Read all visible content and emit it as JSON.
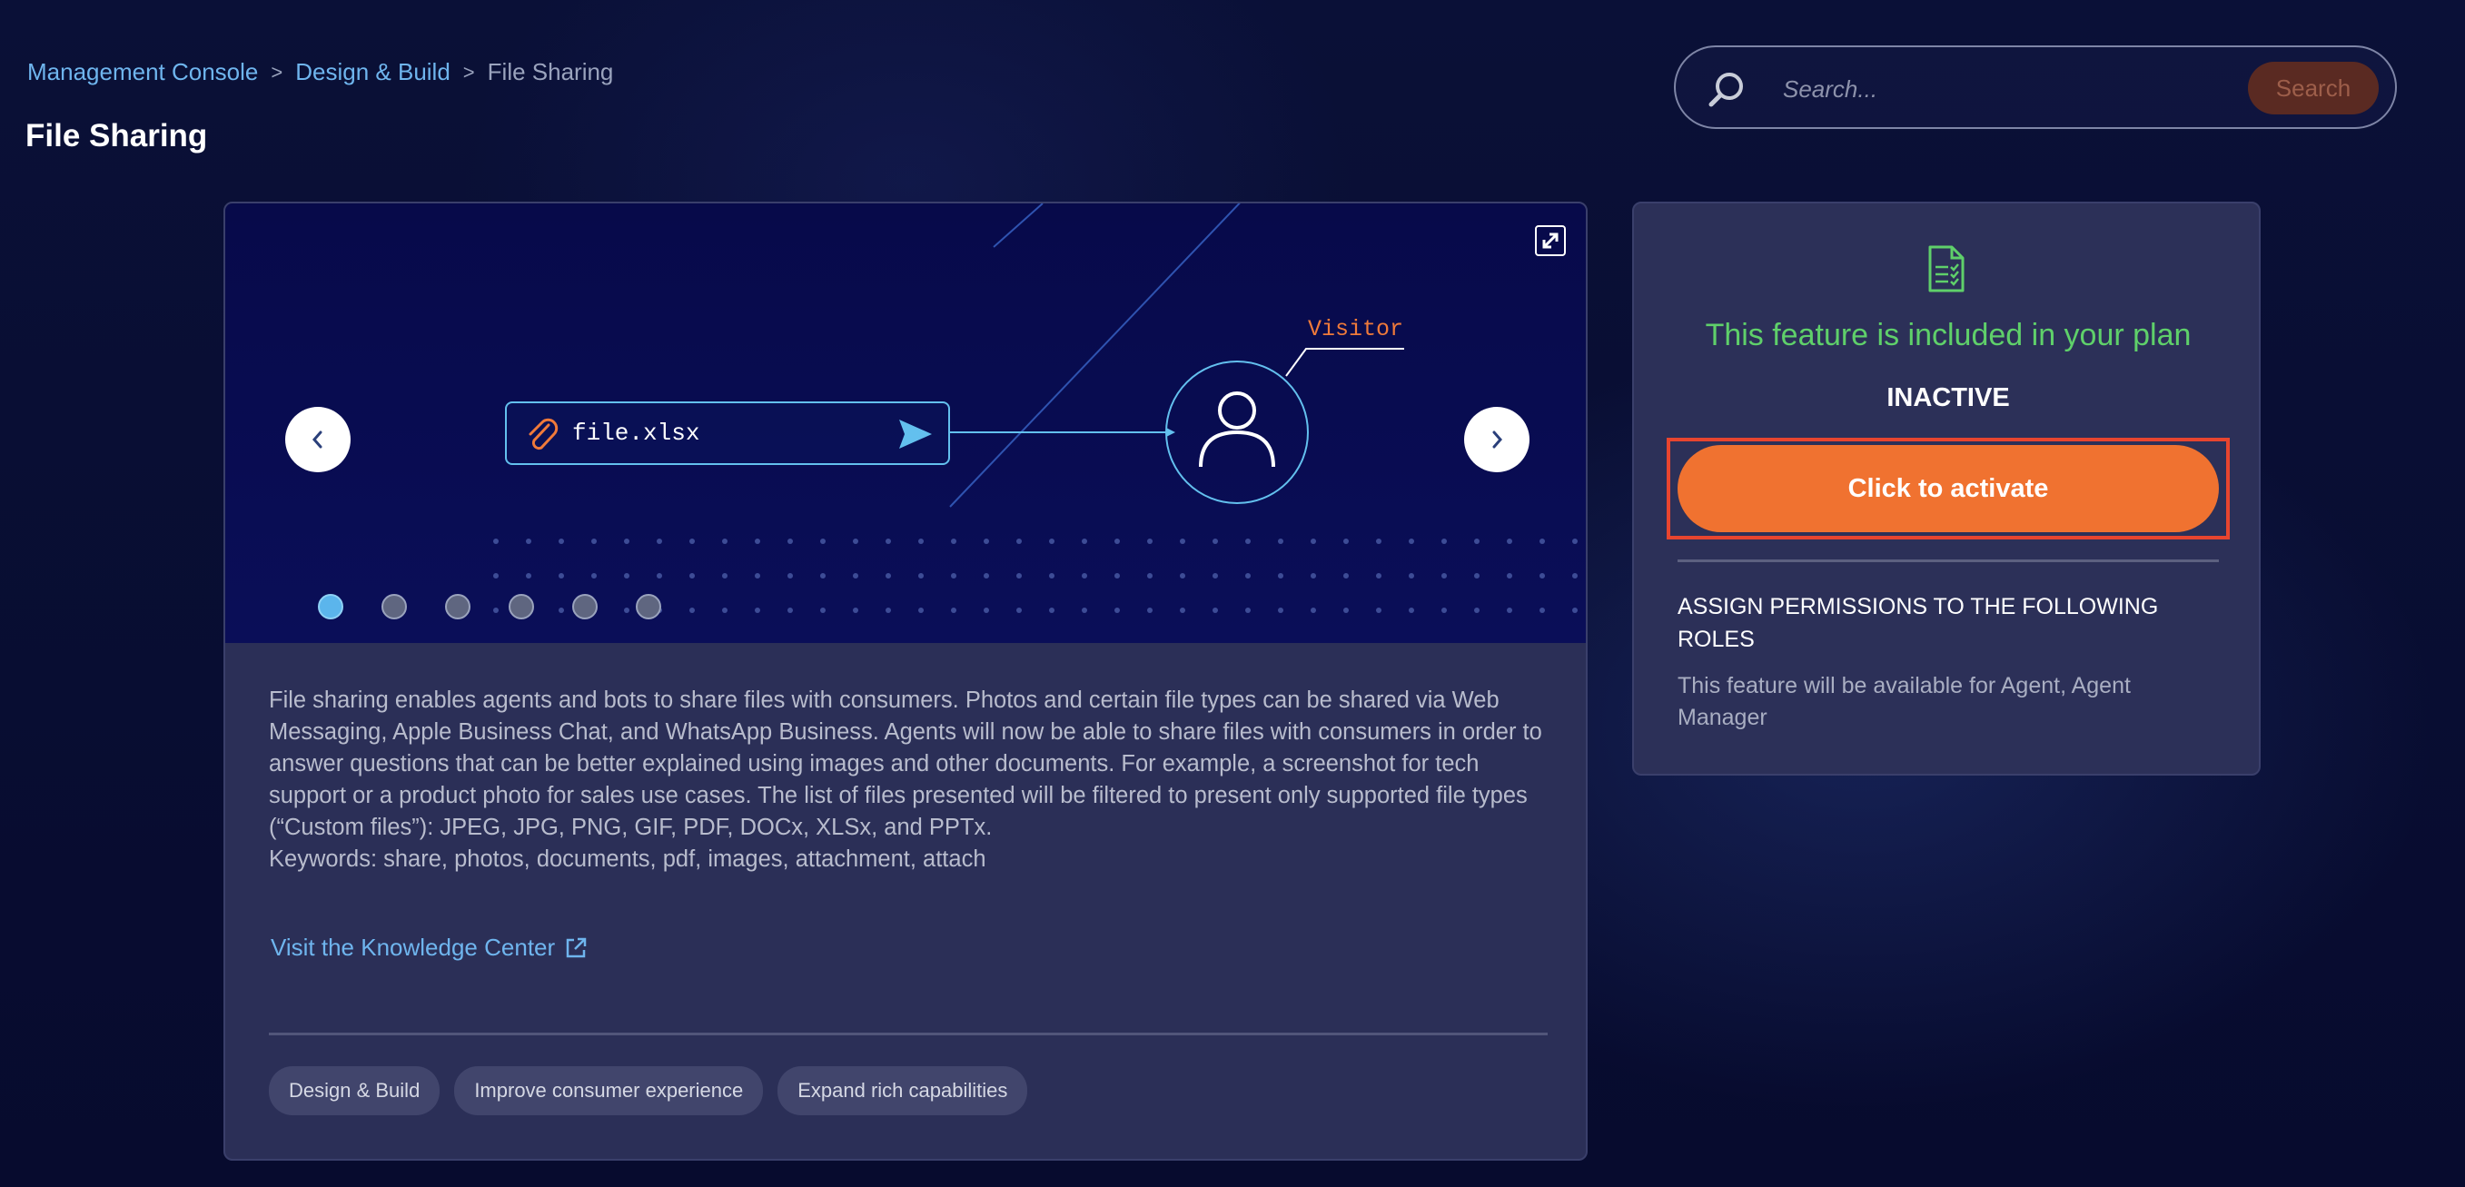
{
  "breadcrumb": {
    "items": [
      "Management Console",
      "Design & Build"
    ],
    "current": "File Sharing",
    "separator": ">"
  },
  "page": {
    "title": "File Sharing"
  },
  "search": {
    "placeholder": "Search...",
    "button_label": "Search"
  },
  "carousel": {
    "file_name": "file.xlsx",
    "visitor_label": "Visitor",
    "active_slide": 1,
    "slide_count": 6
  },
  "description": {
    "paragraph": "File sharing enables agents and bots to share files with consumers. Photos and certain file types can be shared via Web Messaging, Apple Business Chat, and WhatsApp Business. Agents will now be able to share files with consumers in order to answer questions that can be better explained using images and other documents. For example, a screenshot for tech support or a product photo for sales use cases. The list of files presented will be filtered to present only supported file types (“Custom files”): JPEG, JPG, PNG, GIF, PDF, DOCx, XLSx, and PPTx.",
    "keywords": "Keywords: share, photos, documents, pdf, images, attachment, attach"
  },
  "knowledge_link": {
    "label": "Visit the Knowledge Center"
  },
  "tags": [
    "Design & Build",
    "Improve consumer experience",
    "Expand rich capabilities"
  ],
  "plan": {
    "included_text": "This feature is included in your plan",
    "status": "INACTIVE",
    "activate_label": "Click to activate",
    "permissions_title": "ASSIGN PERMISSIONS TO THE FOLLOWING ROLES",
    "permissions_desc": "This feature will be available for Agent, Agent Manager"
  },
  "colors": {
    "accent_orange": "#f07230",
    "link_blue": "#6fb5ee",
    "success_green": "#5fd06a",
    "highlight_red": "#e8452f"
  },
  "icons": [
    "search-icon",
    "expand-icon",
    "chevron-left-icon",
    "chevron-right-icon",
    "paperclip-icon",
    "send-icon",
    "user-icon",
    "external-link-icon",
    "document-check-icon"
  ]
}
